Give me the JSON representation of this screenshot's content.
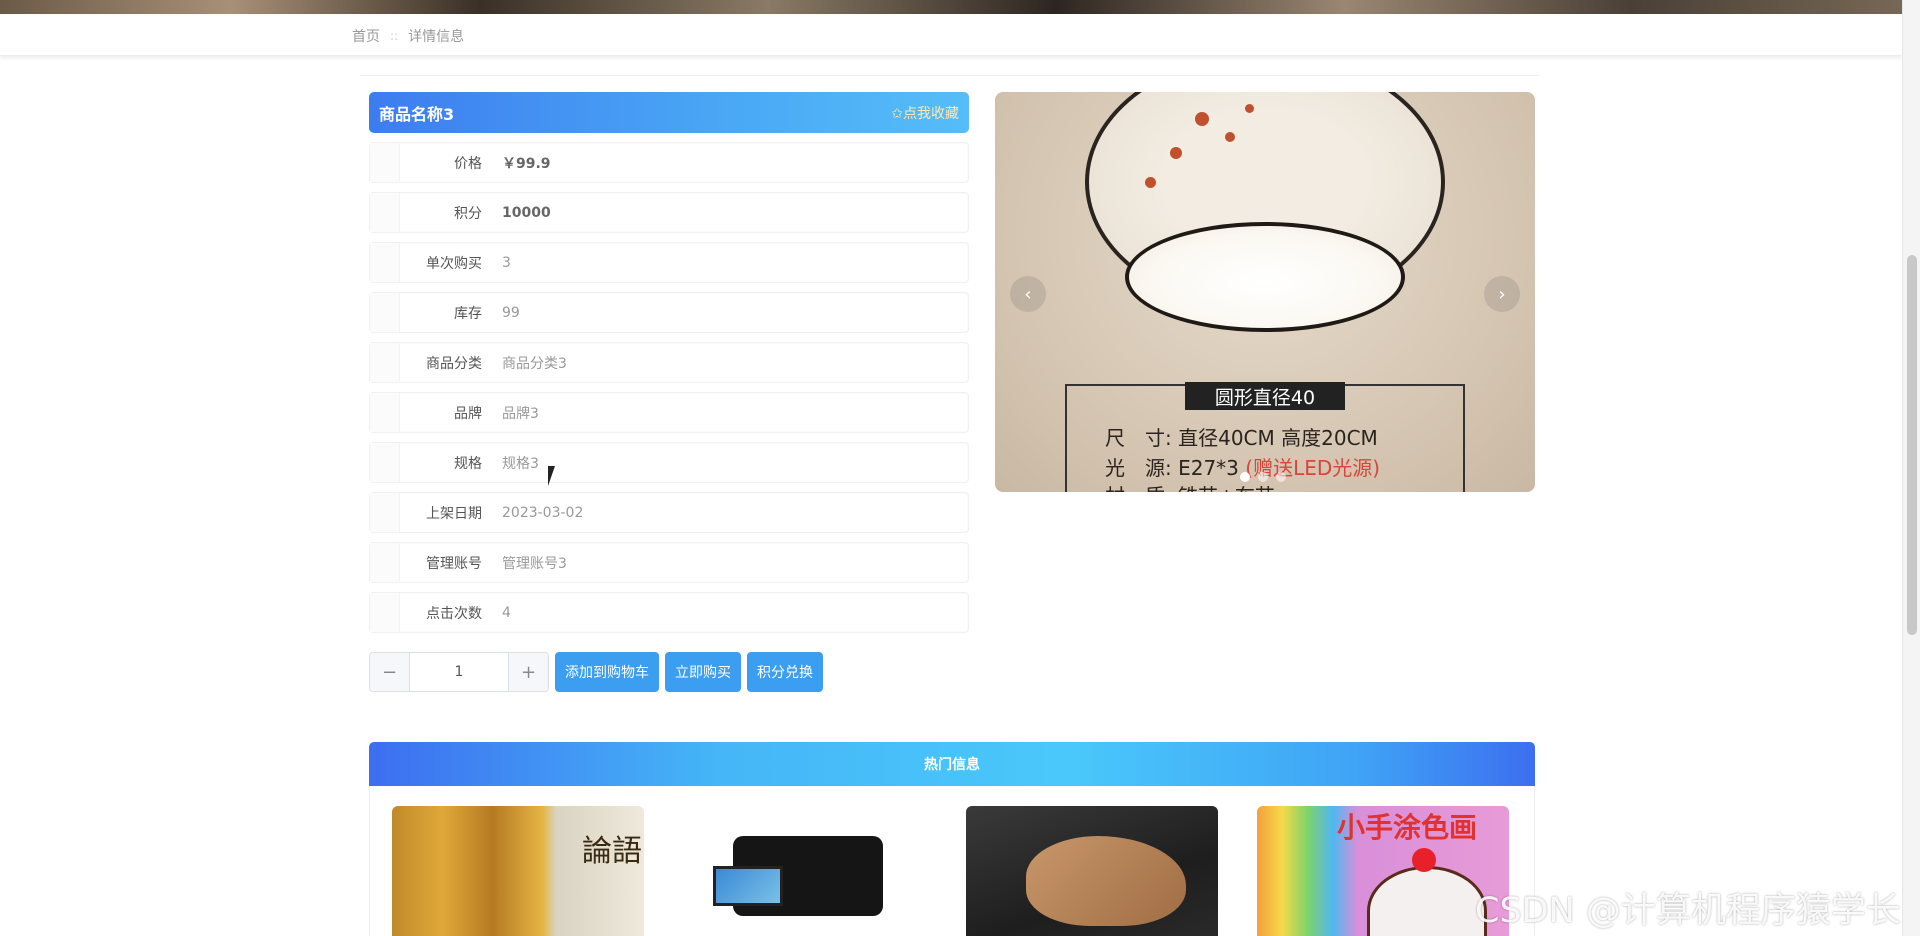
{
  "breadcrumb": {
    "home": "首页",
    "separator": "::",
    "current": "详情信息"
  },
  "product": {
    "name": "商品名称3",
    "favorite_label": "✩点我收藏",
    "fields": [
      {
        "label": "价格",
        "value": "￥99.9",
        "strong": true
      },
      {
        "label": "积分",
        "value": "10000",
        "strong": true
      },
      {
        "label": "单次购买",
        "value": "3"
      },
      {
        "label": "库存",
        "value": "99"
      },
      {
        "label": "商品分类",
        "value": "商品分类3"
      },
      {
        "label": "品牌",
        "value": "品牌3"
      },
      {
        "label": "规格",
        "value": "规格3"
      },
      {
        "label": "上架日期",
        "value": "2023-03-02"
      },
      {
        "label": "管理账号",
        "value": "管理账号3"
      },
      {
        "label": "点击次数",
        "value": "4"
      }
    ]
  },
  "quantity": {
    "minus": "−",
    "value": "1",
    "plus": "+"
  },
  "actions": {
    "add_to_cart": "添加到购物车",
    "buy_now": "立即购买",
    "points_exchange": "积分兑换"
  },
  "carousel": {
    "prev": "‹",
    "next": "›",
    "image_text": {
      "title": "圆形直径40",
      "line1": "尺　寸: 直径40CM 高度20CM",
      "line2_prefix": "光　源: E27*3 ",
      "line2_red": "(赠送LED光源)",
      "line3": "材　质: 铁艺+布艺"
    },
    "slide_count": 3,
    "active_slide": 1
  },
  "hot": {
    "title": "热门信息",
    "cards": [
      {
        "text": "論語"
      },
      {
        "text": ""
      },
      {
        "text": ""
      },
      {
        "text": "小手涂色画"
      }
    ]
  },
  "watermark": "CSDN @计算机程序猿学长",
  "colors": {
    "accent": "#3b9ef0",
    "title_gradient_start": "#3d7cf0",
    "title_gradient_end": "#55bdf8"
  }
}
